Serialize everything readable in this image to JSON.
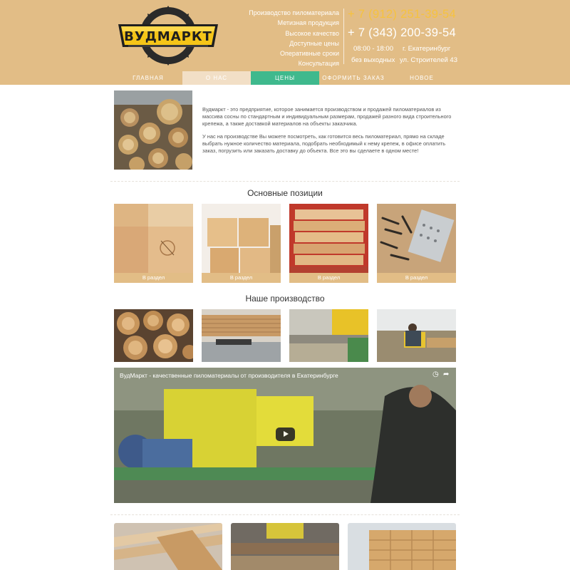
{
  "brand": {
    "logo_text": "ВУДМАРКТ"
  },
  "header": {
    "taglines": [
      "Производство пиломатериала",
      "Метизная продукция",
      "Высокое качество",
      "Доступные цены",
      "Оперативные сроки",
      "Консультация"
    ],
    "phones": [
      "+ 7 (912) 251-39-54",
      "+ 7 (343) 200-39-54"
    ],
    "hours": "08:00 - 18:00",
    "days": "без выходных",
    "city": "г. Екатеринбург",
    "address": "ул. Строителей 43"
  },
  "nav": {
    "items": [
      "ГЛАВНАЯ",
      "О НАС",
      "ЦЕНЫ",
      "ОФОРМИТЬ ЗАКАЗ",
      "НОВОЕ"
    ]
  },
  "about": {
    "paragraphs": [
      "Вудмаркт - это предприятие, которое занимается производством и продажей пиломатериалов из массива сосны по стандартным и индивидуальным размерам, продажей разного вида строительного крепежа, а также доставкой материалов на объекты заказчика.",
      "У нас на производстве Вы можете посмотреть, как готовится весь пиломатериал, прямо на складе выбрать нужное количество материала, подобрать необходимый к нему крепеж, в офисе оплатить заказ, погрузить или заказать доставку до объекта. Все это вы сделаете в одном месте!"
    ]
  },
  "positions": {
    "title": "Основные позиции",
    "cards": [
      {
        "button": "В раздел"
      },
      {
        "button": "В раздел"
      },
      {
        "button": "В раздел"
      },
      {
        "button": "В раздел"
      }
    ]
  },
  "production": {
    "title": "Наше производство"
  },
  "video": {
    "title": "ВудМаркт - качественные пиломатериалы от производителя в Екатеринбурге",
    "icons": [
      "clock-icon",
      "share-icon",
      "play-icon"
    ]
  },
  "colors": {
    "header_bg": "#e2bd86",
    "accent_yellow": "#f6c23e",
    "nav_active_about": "#f2dfc6",
    "nav_active_prices": "#3fb98d",
    "logo_yellow": "#f5c518",
    "logo_dark": "#1f1f1f"
  }
}
